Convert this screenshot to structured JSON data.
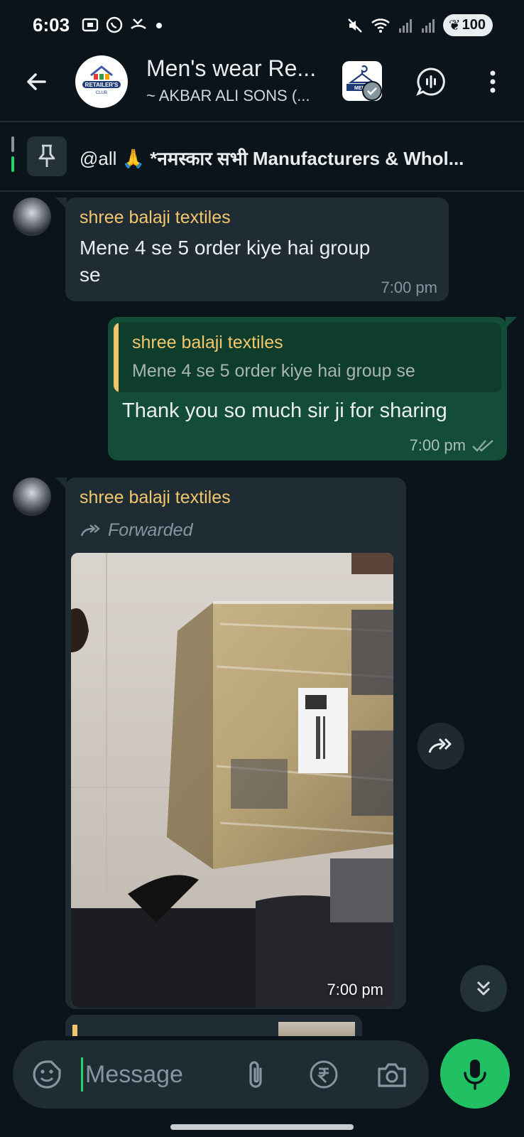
{
  "status_bar": {
    "time": "6:03",
    "battery": "100"
  },
  "header": {
    "group_name": "Men's wear Re...",
    "group_subtitle": "~ AKBAR ALI SONS (...",
    "avatar_logo_text": "RETAILER'S CLUB"
  },
  "pinned": {
    "mention": "@all",
    "emoji": "🙏",
    "text": "*नमस्कार सभी Manufacturers & Whol..."
  },
  "messages": [
    {
      "direction": "incoming",
      "sender": "shree balaji textiles",
      "text_line1": "Mene 4 se 5 order kiye hai group",
      "text_line2": "se",
      "time": "7:00 pm"
    },
    {
      "direction": "outgoing",
      "quoted_sender": "shree balaji textiles",
      "quoted_text": "Mene 4 se 5 order kiye hai group se",
      "text": "Thank you so much sir ji for sharing",
      "time": "7:00 pm",
      "status": "read"
    },
    {
      "direction": "incoming",
      "sender": "shree balaji textiles",
      "forwarded_label": "Forwarded",
      "media": "photo",
      "time": "7:00 pm"
    }
  ],
  "composer": {
    "placeholder": "Message"
  },
  "colors": {
    "background": "#0b141a",
    "incoming_bubble": "#202c33",
    "outgoing_bubble": "#134d37",
    "sender_name": "#f2c66d",
    "accent_green": "#21c063"
  },
  "icons": [
    "back-arrow-icon",
    "pin-icon",
    "voice-chat-icon",
    "more-vert-icon",
    "forward-icon",
    "share-icon",
    "double-chevron-down-icon",
    "sticker-icon",
    "attach-icon",
    "rupee-icon",
    "camera-icon",
    "mic-icon",
    "double-check-icon"
  ]
}
